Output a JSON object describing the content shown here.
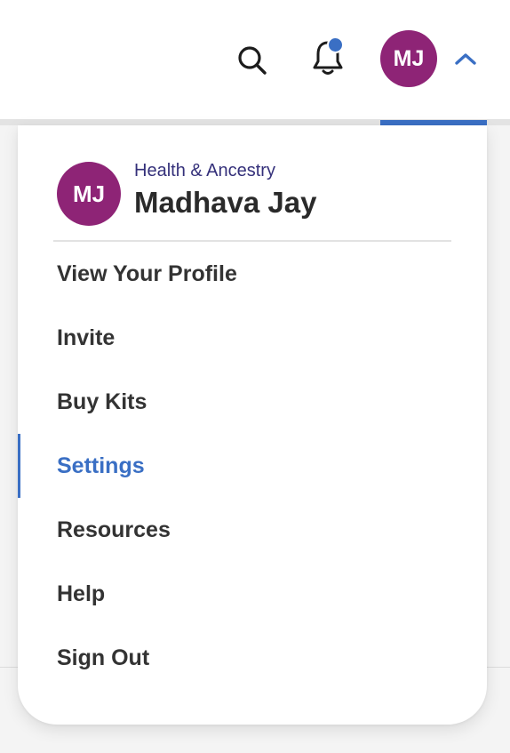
{
  "header": {
    "icons": {
      "search": "search-icon",
      "notifications": "bell-icon",
      "toggle": "chevron-up-icon"
    },
    "has_unread_notifications": true,
    "avatar_initials": "MJ"
  },
  "menu": {
    "user": {
      "initials": "MJ",
      "product": "Health & Ancestry",
      "name": "Madhava Jay"
    },
    "items": [
      {
        "label": "View Your Profile",
        "active": false
      },
      {
        "label": "Invite",
        "active": false
      },
      {
        "label": "Buy Kits",
        "active": false
      },
      {
        "label": "Settings",
        "active": true
      },
      {
        "label": "Resources",
        "active": false
      },
      {
        "label": "Help",
        "active": false
      },
      {
        "label": "Sign Out",
        "active": false
      }
    ]
  },
  "colors": {
    "accent": "#3a6fc4",
    "avatar": "#8e2476",
    "product_label": "#34307a",
    "text": "#333333"
  }
}
